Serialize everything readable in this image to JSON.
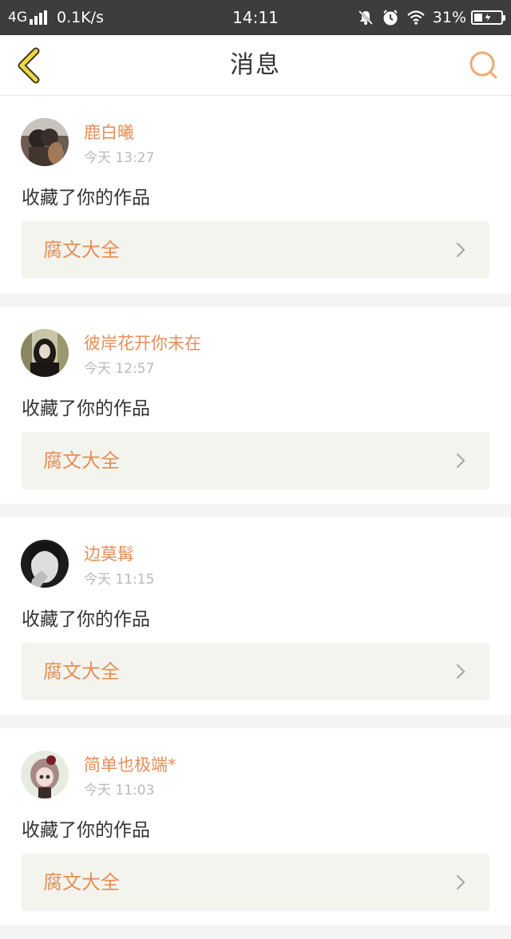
{
  "status_bar": {
    "network": "4G",
    "speed": "0.1K/s",
    "time": "14:11",
    "battery": "31%",
    "battery_level": 0.31,
    "icons": [
      "signal-icon",
      "mute-icon",
      "alarm-icon",
      "wifi-icon",
      "battery-icon"
    ]
  },
  "header": {
    "title": "消息",
    "back_icon": "chevron-left-icon",
    "search_icon": "search-icon"
  },
  "colors": {
    "accent": "#e58e58",
    "back_arrow": "#f2d54a",
    "status_bar_bg": "#3d3d3d"
  },
  "messages": [
    {
      "user": "鹿白曦",
      "time": "今天 13:27",
      "action": "收藏了你的作品",
      "work": "腐文大全"
    },
    {
      "user": "彼岸花开你未在",
      "time": "今天 12:57",
      "action": "收藏了你的作品",
      "work": "腐文大全"
    },
    {
      "user": "边莫髯",
      "time": "今天 11:15",
      "action": "收藏了你的作品",
      "work": "腐文大全"
    },
    {
      "user": "简单也极端*",
      "time": "今天 11:03",
      "action": "收藏了你的作品",
      "work": "腐文大全"
    }
  ]
}
